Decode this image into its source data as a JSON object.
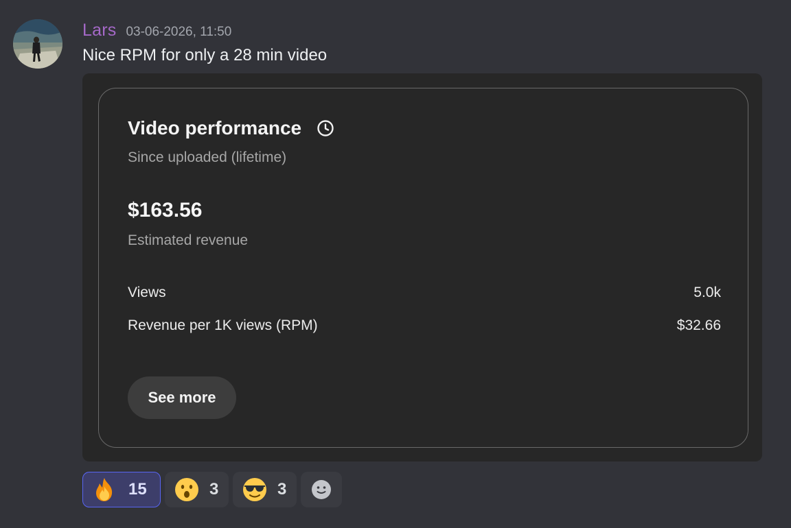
{
  "message": {
    "username": "Lars",
    "timestamp": "03-06-2026, 11:50",
    "text": "Nice RPM for only a 28 min video"
  },
  "card": {
    "title": "Video performance",
    "subtitle": "Since uploaded (lifetime)",
    "revenue_value": "$163.56",
    "revenue_label": "Estimated revenue",
    "metrics": [
      {
        "label": "Views",
        "value": "5.0k"
      },
      {
        "label": "Revenue per 1K views (RPM)",
        "value": "$32.66"
      }
    ],
    "see_more_label": "See more"
  },
  "reactions": [
    {
      "emoji": "fire",
      "count": "15",
      "active": true
    },
    {
      "emoji": "hushed-face",
      "count": "3",
      "active": false
    },
    {
      "emoji": "sunglasses-face",
      "count": "3",
      "active": false
    }
  ],
  "colors": {
    "background": "#323339",
    "username": "#a569c8",
    "active_reaction_border": "#5865f2"
  }
}
